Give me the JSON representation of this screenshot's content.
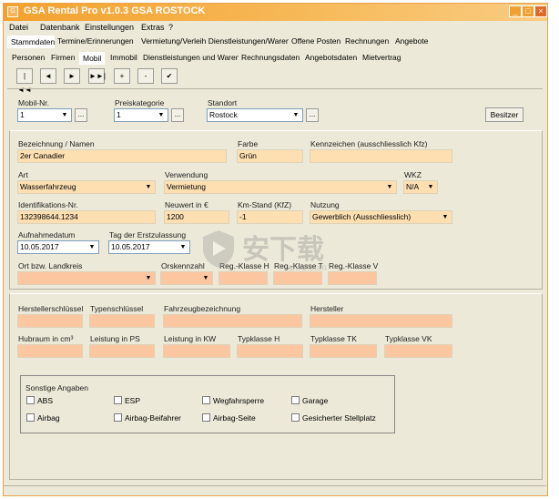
{
  "window": {
    "title": "GSA Rental Pro v1.0.3  GSA ROSTOCK"
  },
  "menu": [
    "Datei",
    "Datenbank",
    "Einstellungen",
    "Extras",
    "?"
  ],
  "main_tabs": [
    "Stammdaten",
    "Termine/Erinnerungen",
    "Vermietung/Verleih Dienstleistungen/Waren",
    "Offene Posten",
    "Rechnungen",
    "Angebote"
  ],
  "sub_tabs": [
    "Personen",
    "Firmen",
    "Mobil",
    "Immobil",
    "Dienstleistungen und Waren",
    "Rechnungsdaten",
    "Angebotsdaten",
    "Mietvertrag"
  ],
  "toolbar": {
    "first": "|◄◄",
    "prev": "◄",
    "next": "►",
    "last": "►►|",
    "add": "+",
    "remove": "-",
    "confirm": "✔"
  },
  "header": {
    "mobil_nr_label": "Mobil-Nr.",
    "mobil_nr_value": "1",
    "preiskategorie_label": "Preiskategorie",
    "preiskategorie_value": "1",
    "standort_label": "Standort",
    "standort_value": "Rostock",
    "browse": "...",
    "besitzer_button": "Besitzer"
  },
  "vehicle": {
    "bezeichnung_label": "Bezeichnung / Namen",
    "bezeichnung_value": "2er Canadier",
    "farbe_label": "Farbe",
    "farbe_value": "Grün",
    "kennzeichen_label": "Kennzeichen (ausschliesslich Kfz)",
    "kennzeichen_value": "",
    "art_label": "Art",
    "art_value": "Wasserfahrzeug",
    "verwendung_label": "Verwendung",
    "verwendung_value": "Vermietung",
    "wkz_label": "WKZ",
    "wkz_value": "N/A",
    "ident_label": "Identifikations-Nr.",
    "ident_value": "132398644.1234",
    "neuwert_label": "Neuwert in €",
    "neuwert_value": "1200",
    "kmstand_label": "Km-Stand (KfZ)",
    "kmstand_value": "-1",
    "nutzung_label": "Nutzung",
    "nutzung_value": "Gewerblich (Ausschliesslich)",
    "aufnahme_label": "Aufnahmedatum",
    "aufnahme_value": "10.05.2017",
    "erstzulassung_label": "Tag der Erstzulassung",
    "erstzulassung_value": "10.05.2017",
    "ort_label": "Ort bzw. Landkreis",
    "ortskennzahl_label": "Orskennzahl",
    "regklasse_h_label": "Reg.-Klasse H",
    "regklasse_t_label": "Reg.-Klasse T",
    "regklasse_v_label": "Reg.-Klasse V"
  },
  "technical": {
    "herstellerschluessel": "Herstellerschlüssel",
    "typenschluessel": "Typenschlüssel",
    "fahrzeugbezeichnung": "Fahrzeugbezeichnung",
    "hersteller": "Hersteller",
    "hubraum": "Hubraum in cm³",
    "leistung_ps": "Leistung in PS",
    "leistung_kw": "Leistung in KW",
    "typklasse_h": "Typklasse H",
    "typklasse_tk": "Typklasse TK",
    "typklasse_vk": "Typklasse VK"
  },
  "sonstige": {
    "title": "Sonstige Angaben",
    "items": [
      "ABS",
      "ESP",
      "Wegfahrsperre",
      "Garage",
      "Airbag",
      "Airbag-Beifahrer",
      "Airbag-Seite",
      "Gesicherter Stellplatz"
    ]
  },
  "watermark": {
    "text": "安下载",
    "sub": "anxz.com"
  }
}
